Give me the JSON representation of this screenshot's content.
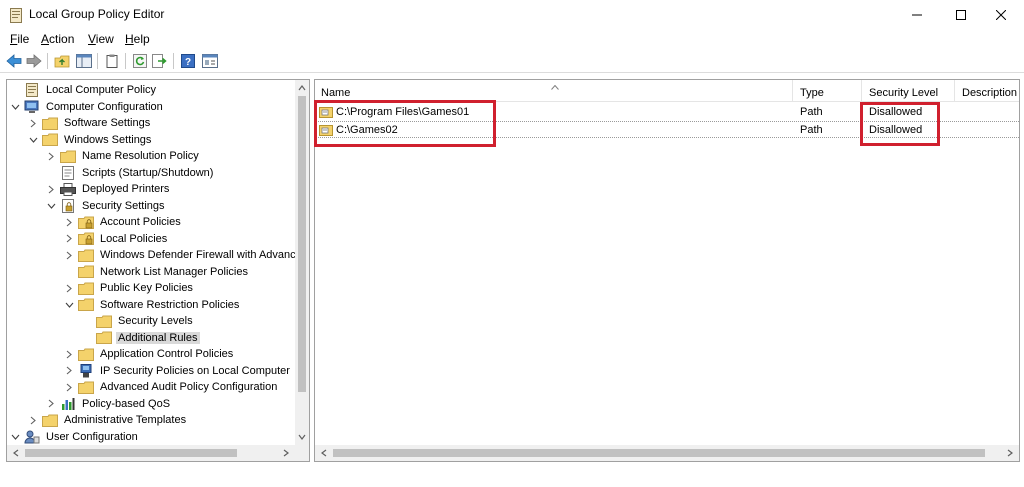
{
  "window": {
    "title": "Local Group Policy Editor",
    "app_icon": "policy-document-icon",
    "controls": [
      "minimize-icon",
      "maximize-icon",
      "close-icon"
    ]
  },
  "menu": {
    "file": {
      "key": "F",
      "rest": "ile"
    },
    "action": {
      "key": "A",
      "rest": "ction"
    },
    "view": {
      "key": "V",
      "rest": "iew"
    },
    "help": {
      "key": "H",
      "rest": "elp"
    }
  },
  "toolbar": {
    "buttons": [
      "back-icon",
      "forward-icon",
      "up-folder-icon",
      "show-hide-tree-icon",
      "clipboard-icon",
      "refresh-icon",
      "export-list-icon",
      "help-icon",
      "properties-icon"
    ]
  },
  "tree": {
    "items": [
      {
        "label": "Local Computer Policy",
        "icon": "policy-document-icon",
        "arrow": "none"
      },
      {
        "label": "Computer Configuration",
        "icon": "computer-icon",
        "arrow": "expanded"
      },
      {
        "label": "Software Settings",
        "icon": "folder-icon",
        "arrow": "collapsed"
      },
      {
        "label": "Windows Settings",
        "icon": "folder-icon",
        "arrow": "expanded"
      },
      {
        "label": "Name Resolution Policy",
        "icon": "folder-icon",
        "arrow": "collapsed"
      },
      {
        "label": "Scripts (Startup/Shutdown)",
        "icon": "script-icon",
        "arrow": "none"
      },
      {
        "label": "Deployed Printers",
        "icon": "printer-icon",
        "arrow": "collapsed"
      },
      {
        "label": "Security Settings",
        "icon": "security-settings-icon",
        "arrow": "expanded"
      },
      {
        "label": "Account Policies",
        "icon": "locked-folder-icon",
        "arrow": "collapsed"
      },
      {
        "label": "Local Policies",
        "icon": "locked-folder-icon",
        "arrow": "collapsed"
      },
      {
        "label": "Windows Defender Firewall with Advanc",
        "icon": "folder-icon",
        "arrow": "collapsed"
      },
      {
        "label": "Network List Manager Policies",
        "icon": "folder-icon",
        "arrow": "none"
      },
      {
        "label": "Public Key Policies",
        "icon": "folder-icon",
        "arrow": "collapsed"
      },
      {
        "label": "Software Restriction Policies",
        "icon": "folder-icon",
        "arrow": "expanded"
      },
      {
        "label": "Security Levels",
        "icon": "folder-icon",
        "arrow": "none"
      },
      {
        "label": "Additional Rules",
        "icon": "folder-icon",
        "arrow": "none",
        "selected": true
      },
      {
        "label": "Application Control Policies",
        "icon": "folder-icon",
        "arrow": "collapsed"
      },
      {
        "label": "IP Security Policies on Local Computer",
        "icon": "ip-security-icon",
        "arrow": "collapsed"
      },
      {
        "label": "Advanced Audit Policy Configuration",
        "icon": "folder-icon",
        "arrow": "collapsed"
      },
      {
        "label": "Policy-based QoS",
        "icon": "bar-chart-icon",
        "arrow": "collapsed"
      },
      {
        "label": "Administrative Templates",
        "icon": "folder-icon",
        "arrow": "collapsed"
      },
      {
        "label": "User Configuration",
        "icon": "user-icon",
        "arrow": "expanded"
      }
    ]
  },
  "list": {
    "columns": [
      "Name",
      "Type",
      "Security Level",
      "Description"
    ],
    "rows": [
      {
        "name": "C:\\Program Files\\Games01",
        "type": "Path",
        "security_level": "Disallowed",
        "description": "",
        "icon": "path-rule-icon"
      },
      {
        "name": "C:\\Games02",
        "type": "Path",
        "security_level": "Disallowed",
        "description": "",
        "icon": "path-rule-icon"
      }
    ]
  },
  "colors": {
    "highlight_box": "#d0202e",
    "folder": "#f4d26b",
    "selection": "#d9d9d9"
  }
}
